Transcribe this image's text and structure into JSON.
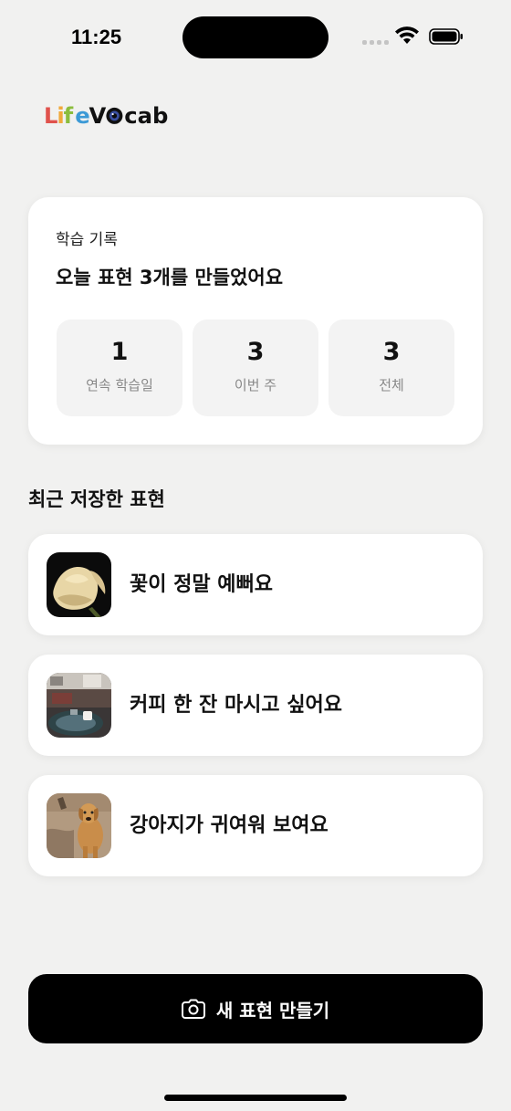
{
  "status_bar": {
    "time": "11:25"
  },
  "logo": {
    "text": "LifeVocab"
  },
  "summary": {
    "label": "학습 기록",
    "headline": "오늘 표현 3개를 만들었어요",
    "stats": [
      {
        "value": "1",
        "label": "연속 학습일"
      },
      {
        "value": "3",
        "label": "이번 주"
      },
      {
        "value": "3",
        "label": "전체"
      }
    ]
  },
  "recent": {
    "title": "최근 저장한 표현",
    "items": [
      {
        "text": "꽃이 정말 예뻐요",
        "thumbnail": "flower-photo"
      },
      {
        "text": "커피 한 잔 마시고 싶어요",
        "thumbnail": "cafe-photo"
      },
      {
        "text": "강아지가 귀여워 보여요",
        "thumbnail": "dog-photo"
      }
    ]
  },
  "actions": {
    "new_label": "새 표현 만들기",
    "new_icon": "camera-icon"
  },
  "colors": {
    "background": "#f1f1f0",
    "card": "#ffffff",
    "button": "#000000",
    "stat_tile": "#f3f3f3"
  }
}
